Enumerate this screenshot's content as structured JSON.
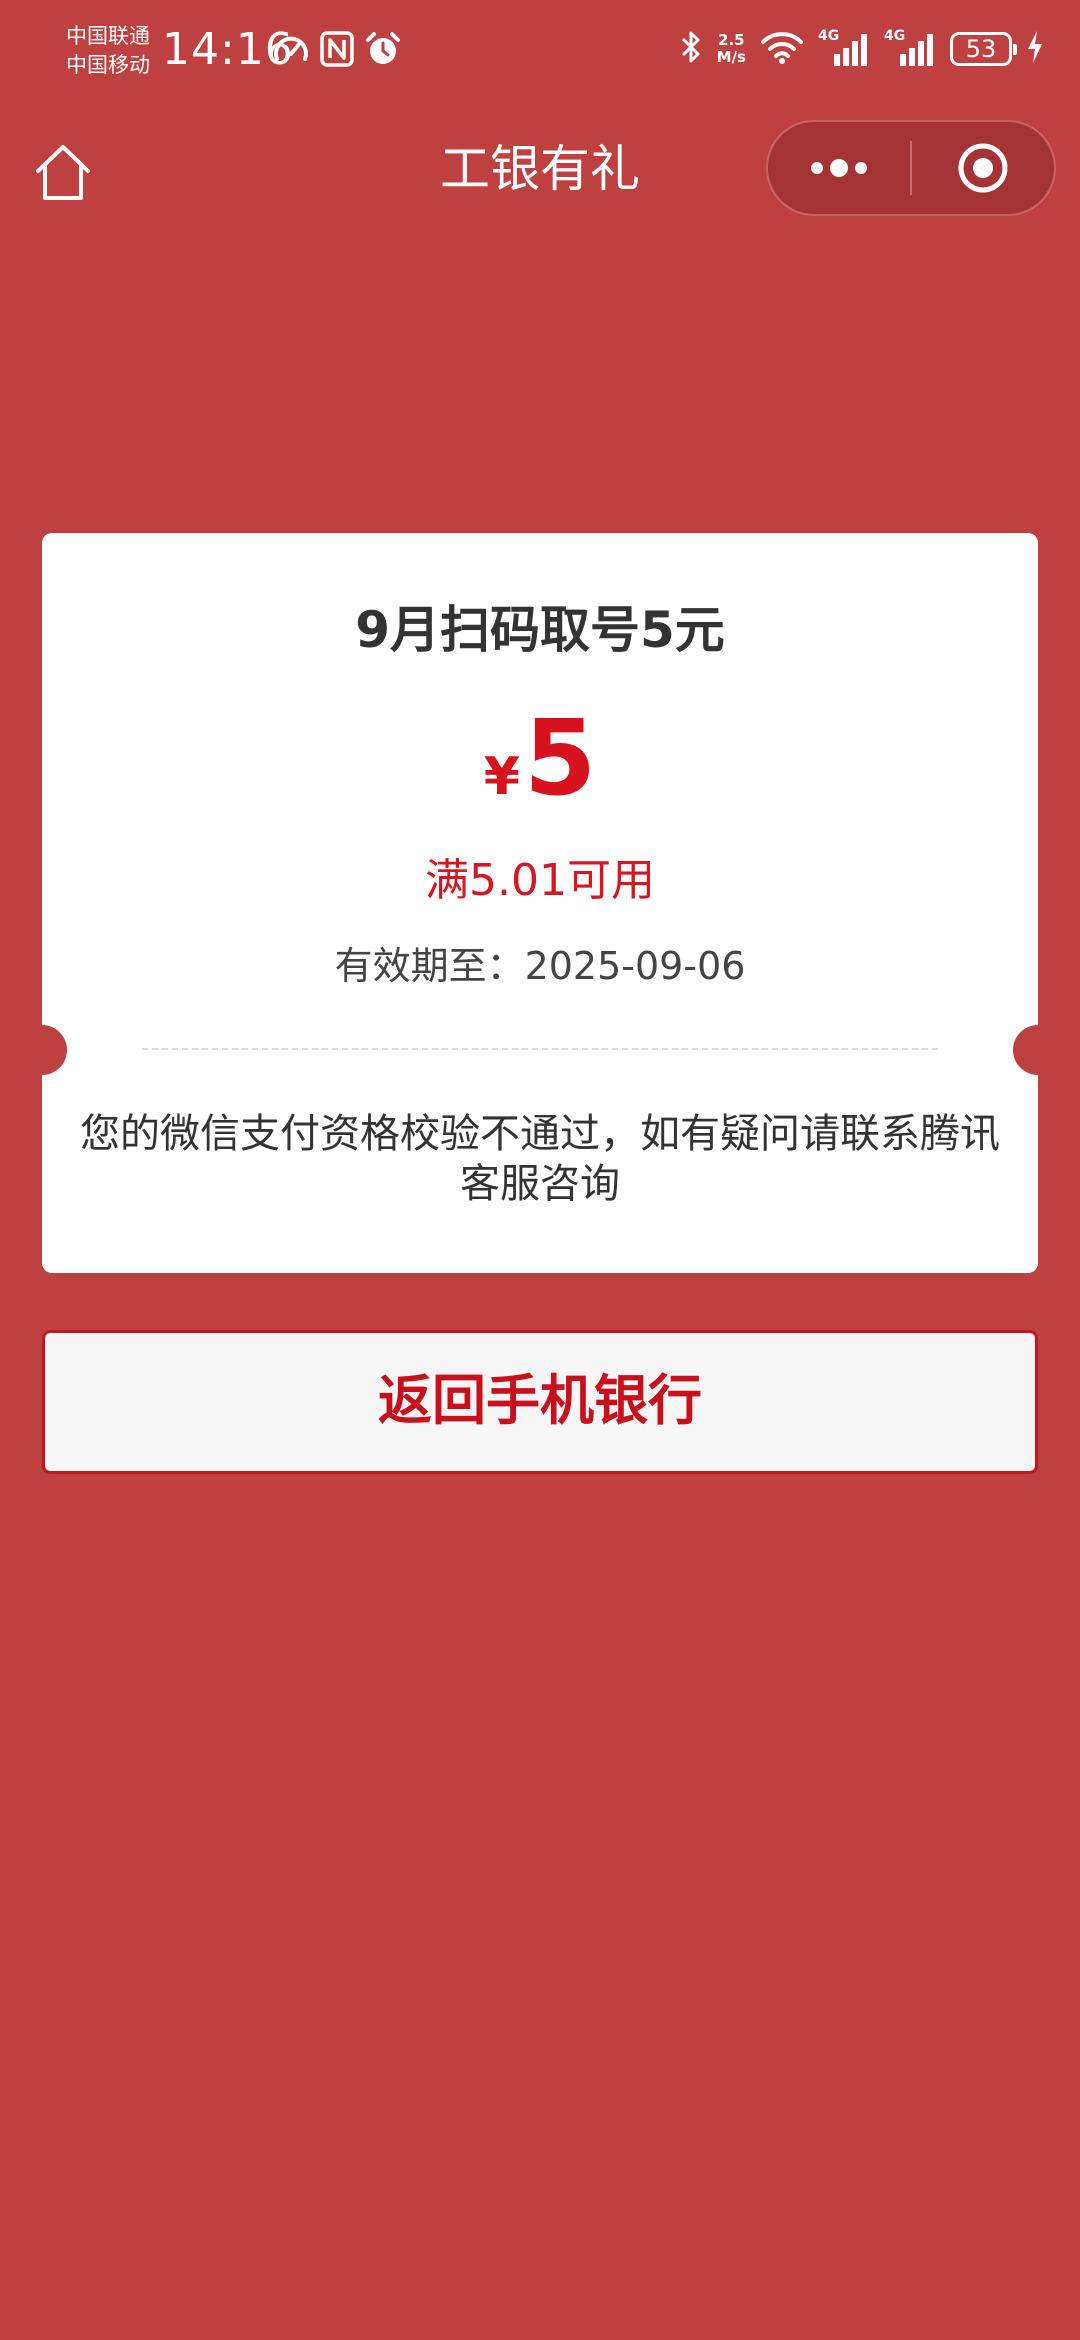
{
  "status_bar": {
    "carrier_1": "中国联通",
    "carrier_2": "中国移动",
    "time": "14:16",
    "net_speed_value": "2.5",
    "net_speed_unit": "M/s",
    "signal_1_label": "4G",
    "signal_2_label": "4G",
    "battery_level": "53",
    "icons": [
      "speed-icon",
      "nfc-icon",
      "alarm-icon",
      "bluetooth-icon",
      "wifi-icon",
      "signal-icon",
      "battery-icon",
      "charging-icon"
    ]
  },
  "nav": {
    "title": "工银有礼",
    "home_icon": "home-icon",
    "more_icon": "more-dots-icon",
    "close_icon": "target-close-icon"
  },
  "coupon": {
    "title": "9月扫码取号5元",
    "currency": "¥",
    "amount": "5",
    "threshold": "满5.01可用",
    "validity": "有效期至：2025-09-06",
    "notice": "您的微信支付资格校验不通过，如有疑问请联系腾讯客服咨询"
  },
  "actions": {
    "return_label": "返回手机银行"
  },
  "colors": {
    "background": "#be4040",
    "accent_red": "#d8111f",
    "card": "#ffffff",
    "button_bg": "#f6f6f6"
  }
}
